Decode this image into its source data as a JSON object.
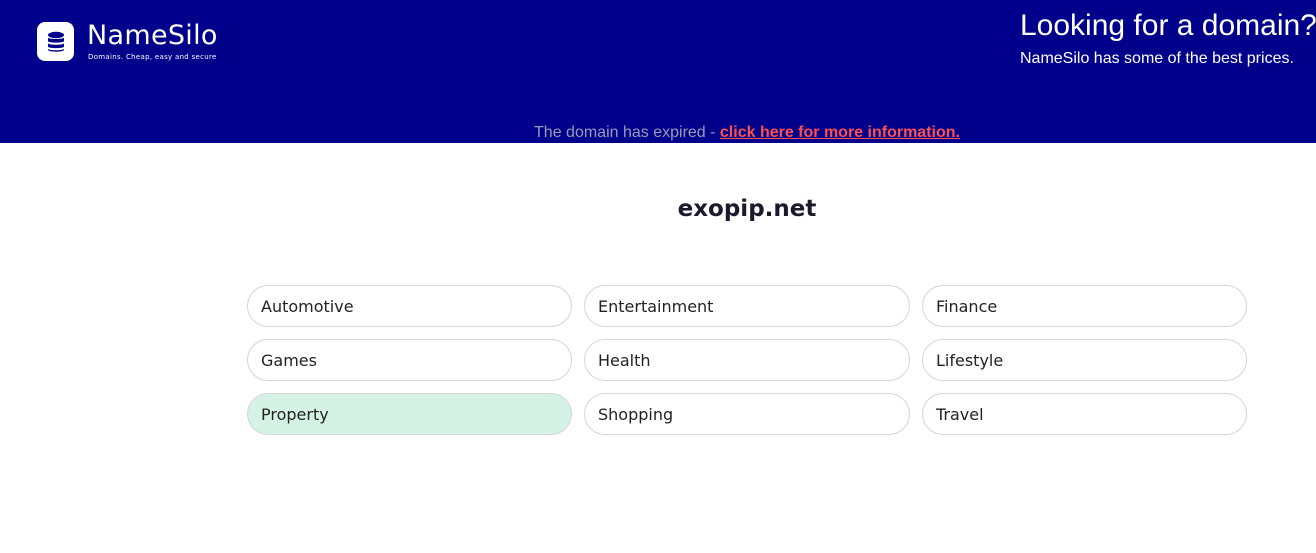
{
  "header": {
    "logo": {
      "name": "NameSilo",
      "tagline": "Domains. Cheap, easy and secure"
    },
    "promo": {
      "title": "Looking for a domain?",
      "subtitle": "NameSilo has some of the best prices."
    },
    "notice": {
      "text": "The domain has expired - ",
      "link_text": "click here for more information."
    }
  },
  "main": {
    "domain": "exopip.net",
    "categories": [
      {
        "label": "Automotive",
        "active": false
      },
      {
        "label": "Entertainment",
        "active": false
      },
      {
        "label": "Finance",
        "active": false
      },
      {
        "label": "Games",
        "active": false
      },
      {
        "label": "Health",
        "active": false
      },
      {
        "label": "Lifestyle",
        "active": false
      },
      {
        "label": "Property",
        "active": true
      },
      {
        "label": "Shopping",
        "active": false
      },
      {
        "label": "Travel",
        "active": false
      }
    ]
  },
  "colors": {
    "header_bg": "#00008b",
    "link": "#ff5050",
    "notice_text": "#9a9ab6",
    "active_category_bg": "#d4f3e6"
  },
  "icons": {
    "logo": "database-icon"
  }
}
